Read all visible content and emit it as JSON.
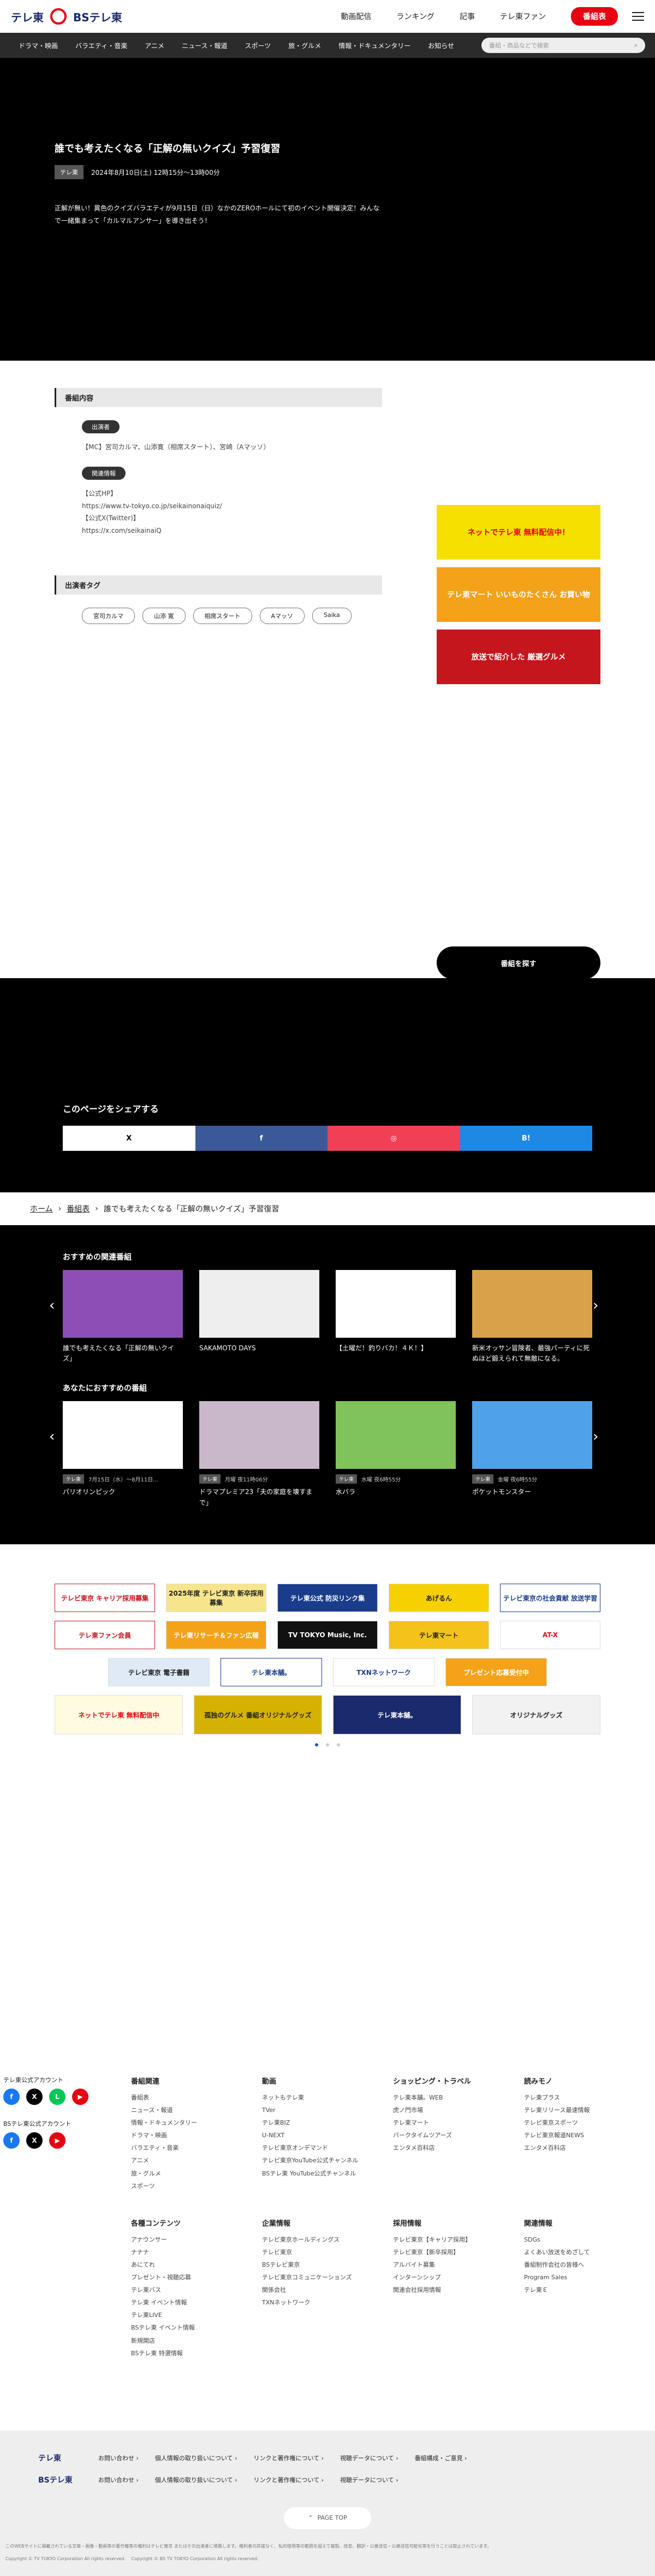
{
  "header": {
    "logo1": "テレ東",
    "logo2": "BSテレ東",
    "nav": [
      "動画配信",
      "ランキング",
      "記事",
      "テレ東ファン"
    ],
    "cta": "番組表"
  },
  "gnav": {
    "items": [
      "ドラマ・映画",
      "バラエティ・音楽",
      "アニメ",
      "ニュース・報道",
      "スポーツ",
      "旅・グルメ",
      "情報・ドキュメンタリー",
      "お知らせ"
    ],
    "search_placeholder": "番組・商品などで検索"
  },
  "hero": {
    "title": "誰でも考えたくなる「正解の無いクイズ」予習復習",
    "channel": "テレ東",
    "datetime": "2024年8月10日(土) 12時15分～13時00分",
    "desc": "正解が無い！異色のクイズバラエティが9月15日（日）なかのZEROホールにて初のイベント開催決定！みんなで一緒集まって「カルマルアンサー」を導き出そう！"
  },
  "info": {
    "section": "番組内容",
    "cast_label": "出演者",
    "cast": "【MC】宮司カルマ、山添寛（相席スタート）、宮崎（Aマッソ）",
    "links_label": "関連情報",
    "links": [
      "【公式HP】",
      "https://www.tv-tokyo.co.jp/seikainonaiquiz/",
      "【公式X(Twitter)】",
      "https://x.com/seikainaiQ"
    ],
    "tags_section": "出演者タグ",
    "tags": [
      "宮司カルマ",
      "山添 寛",
      "相席スタート",
      "Aマッソ",
      "Saika"
    ]
  },
  "ads": [
    "ネットでテレ東 無料配信中！",
    "テレ東マート いいものたくさん お買い物",
    "放送で紹介した 厳選グルメ"
  ],
  "find_button": "番組を探す",
  "share": {
    "title": "このページをシェアする",
    "buttons": [
      "X",
      "f",
      "◎",
      "B!"
    ]
  },
  "breadcrumb": [
    "ホーム",
    "番組表",
    "誰でも考えたくなる「正解の無いクイズ」予習復習"
  ],
  "related": {
    "title": "おすすめの関連番組",
    "items": [
      {
        "title": "誰でも考えたくなる「正解の無いクイズ」",
        "color": "#8b4fb5"
      },
      {
        "title": "SAKAMOTO DAYS",
        "color": "#eeeeee"
      },
      {
        "title": "【土曜だ！釣りバカ！４Ｋ！】",
        "color": "#ffffff"
      },
      {
        "title": "新米オッサン冒険者、最強パーティに死ぬほど鍛えられて無敵になる。",
        "color": "#d9a24a"
      }
    ]
  },
  "for_you": {
    "title": "あなたにおすすめの番組",
    "items": [
      {
        "channel": "テレ東",
        "time": "7月15日（水）～8月11日...",
        "title": "パリオリンピック",
        "color": "#ffffff"
      },
      {
        "channel": "テレ東",
        "time": "月曜 夜11時06分",
        "title": "ドラマプレミア23「夫の家庭を壊すまで」",
        "color": "#c9b8c9"
      },
      {
        "channel": "テレ東",
        "time": "水曜 夜6時55分",
        "title": "水バラ",
        "color": "#7fc35a"
      },
      {
        "channel": "テレ東",
        "time": "金曜 夜6時55分",
        "title": "ポケットモンスター",
        "color": "#4fa2e8"
      }
    ]
  },
  "banners": [
    [
      "テレビ東京 キャリア採用募集",
      "2025年度 テレビ東京 新卒採用募集",
      "テレ東公式 防災リンク集",
      "あげるん",
      "テレビ東京の社会貢献 放送学習"
    ],
    [
      "テレ東ファン会員",
      "テレ東リサーチ＆ファン広報",
      "TV TOKYO Music, Inc.",
      "テレ東マート",
      "AT-X"
    ],
    [
      "テレビ東京 電子書籍",
      "テレ東本舗。",
      "TXNネットワーク",
      "プレゼント応募受付中"
    ],
    [
      "ネットでテレ東 無料配信中",
      "孤独のグルメ 番組オリジナルグッズ",
      "テレ東本舗。",
      "オリジナルグッズ"
    ]
  ],
  "social": {
    "tx_label": "テレ東公式アカウント",
    "bs_label": "BSテレ東公式アカウント"
  },
  "footer_cols": [
    {
      "title": "番組関連",
      "items": [
        "番組表",
        "ニュース・報道",
        "情報・ドキュメンタリー",
        "ドラマ・映画",
        "バラエティ・音楽",
        "アニメ",
        "旅・グルメ",
        "スポーツ"
      ]
    },
    {
      "title": "動画",
      "items": [
        "ネットもテレ東",
        "TVer",
        "テレ東BIZ",
        "U-NEXT",
        "テレビ東京オンデマンド",
        "テレビ東京YouTube公式チャンネル",
        "BSテレ東 YouTube公式チャンネル"
      ]
    },
    {
      "title": "ショッピング・トラベル",
      "items": [
        "テレ東本舗。WEB",
        "虎ノ門市場",
        "テレ東マート",
        "パークタイムツアーズ",
        "エンタメ百科店"
      ]
    },
    {
      "title": "読みモノ",
      "items": [
        "テレ東プラス",
        "テレ東リリース最速情報",
        "テレビ東京スポーツ",
        "テレビ東京報道NEWS",
        "エンタメ百科店"
      ]
    },
    {
      "title": "各種コンテンツ",
      "items": [
        "アナウンサー",
        "ナナナ",
        "あにてれ",
        "プレゼント・視聴応募",
        "テレ東バス",
        "テレ東 イベント情報",
        "テレ東LIVE",
        "BSテレ東 イベント情報",
        "新規開店",
        "BSテレ東 特選情報"
      ]
    },
    {
      "title": "企業情報",
      "items": [
        "テレビ東京ホールディングス",
        "テレビ東京",
        "BSテレビ東京",
        "テレビ東京コミュニケーションズ",
        "関係会社",
        "TXNネットワーク"
      ]
    },
    {
      "title": "採用情報",
      "items": [
        "テレビ東京【キャリア採用】",
        "テレビ東京【新卒採用】",
        "アルバイト募集",
        "インターンシップ",
        "関連会社採用情報"
      ]
    },
    {
      "title": "関連情報",
      "items": [
        "SDGs",
        "よくあい放送をめざして",
        "番組制作会社の皆様へ",
        "Program Sales",
        "テレ東Ｅ"
      ]
    }
  ],
  "fbar": {
    "tx": "テレ東",
    "tx_links": [
      "お問い合わせ ›",
      "個人情報の取り扱いについて ›",
      "リンクと著作権について ›",
      "視聴データについて ›",
      "番組構成・ご意見 ›"
    ],
    "bs": "BSテレ東",
    "bs_links": [
      "お問い合わせ ›",
      "個人情報の取り扱いについて ›",
      "リンクと著作権について ›",
      "視聴データについて ›"
    ],
    "pagetop": "PAGE TOP"
  },
  "copyright": {
    "notice": "このWEBサイトに掲載されている文章・画像・動画等の著作権等の権利はテレビ東京 またはその出演者に帰属します。権利者の許諾なく、私的使用等の範囲を超えて複製、改変、翻訳・公衆送信・公衆送信可能化等を行うことは禁止されています。",
    "tx": "Copyright © TV TOKYO Corporation All rights reserved.",
    "bs": "Copyright © BS TV TOKYO Corporation All rights reserved."
  }
}
